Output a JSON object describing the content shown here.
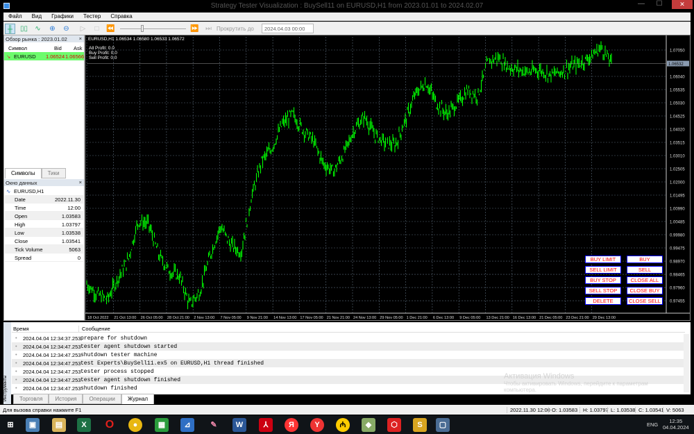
{
  "window": {
    "title": "Strategy Tester Visualization : BuySell11 on EURUSD,H1 from 2023.01.01 to 2024.02.07",
    "close": "✕",
    "minimize": "—",
    "maximize": "☐"
  },
  "menu": [
    "Файл",
    "Вид",
    "Графики",
    "Тестер",
    "Справка"
  ],
  "toolbar": {
    "scroll_to_label": "Прокрутить до",
    "scroll_to_date": "2024.04.03 00:00",
    "speed": 0.3
  },
  "market_watch": {
    "title": "Обзор рынка : 2023.01.02",
    "columns": [
      "Символ",
      "Bid",
      "Ask"
    ],
    "rows": [
      {
        "symbol": "EURUSD",
        "bid": "1.06524",
        "ask": "1.06566"
      }
    ],
    "tabs": [
      "Символы",
      "Тики"
    ]
  },
  "data_window": {
    "title": "Окно данных",
    "symbol": "EURUSD,H1",
    "rows": [
      {
        "k": "Date",
        "v": "2022.11.30"
      },
      {
        "k": "Time",
        "v": "12:00"
      },
      {
        "k": "Open",
        "v": "1.03583"
      },
      {
        "k": "High",
        "v": "1.03797"
      },
      {
        "k": "Low",
        "v": "1.03538"
      },
      {
        "k": "Close",
        "v": "1.03541"
      },
      {
        "k": "Tick Volume",
        "v": "5063"
      },
      {
        "k": "Spread",
        "v": "0"
      }
    ]
  },
  "chart": {
    "header": "EURUSD,H1  1.06534 1.06580 1.06533 1.06572",
    "info": [
      "All Profit: 0.0",
      "Buy Profit: 0.0",
      "Sell Profit: 0.0"
    ],
    "current_price": "1.06532",
    "buttons_left": [
      "BUY LIMIT",
      "SELL LIMIT",
      "BUY STOP",
      "SELL STOP",
      "DELETE"
    ],
    "buttons_right": [
      "BUY",
      "SELL",
      "CLOSE ALL",
      "CLOSE BUY",
      "CLOSE SELL"
    ],
    "colors": {
      "line": "#00ff00",
      "button_text": "#ff0000",
      "button_border": "#0000ff"
    }
  },
  "chart_data": {
    "type": "line",
    "title": "EURUSD,H1",
    "ylim": [
      0.96977,
      1.07555
    ],
    "y_ticks": [
      "1.07050",
      "1.06040",
      "1.05535",
      "1.05030",
      "1.04525",
      "1.04020",
      "1.03515",
      "1.03010",
      "1.02505",
      "1.02000",
      "1.01495",
      "1.00990",
      "1.00485",
      "0.99980",
      "0.99475",
      "0.98970",
      "0.98465",
      "0.97960",
      "0.97455"
    ],
    "x_ticks": [
      "18 Oct 2022",
      "21 Oct 13:00",
      "26 Oct 05:00",
      "28 Oct 21:00",
      "2 Nov 13:00",
      "7 Nov 05:00",
      "9 Nov 21:00",
      "14 Nov 13:00",
      "17 Nov 05:00",
      "21 Nov 21:00",
      "24 Nov 13:00",
      "29 Nov 05:00",
      "1 Dec 21:00",
      "6 Dec 13:00",
      "9 Dec 05:00",
      "13 Dec 21:00",
      "16 Dec 13:00",
      "21 Dec 05:00",
      "23 Dec 21:00",
      "29 Dec 13:00"
    ],
    "values": [
      0.981,
      0.977,
      0.975,
      0.983,
      0.99,
      1.005,
      1.004,
      0.992,
      0.986,
      0.984,
      0.973,
      0.978,
      0.992,
      1.003,
      0.996,
      0.993,
      1.014,
      1.028,
      1.033,
      1.042,
      1.046,
      1.04,
      1.036,
      1.027,
      1.024,
      1.031,
      1.04,
      1.045,
      1.038,
      1.035,
      1.034,
      1.044,
      1.054,
      1.058,
      1.05,
      1.046,
      1.05,
      1.055,
      1.053,
      1.066,
      1.0675,
      1.064,
      1.063,
      1.062,
      1.063,
      1.061,
      1.062,
      1.064,
      1.0655,
      1.068,
      1.0715,
      1.0655
    ]
  },
  "journal": {
    "columns": [
      "Время",
      "Сообщение"
    ],
    "rows": [
      {
        "t": "2024.04.04 12:34:37.253",
        "m": "prepare for shutdown"
      },
      {
        "t": "2024.04.04 12:34:47.253",
        "m": "tester agent shutdown started"
      },
      {
        "t": "2024.04.04 12:34:47.253",
        "m": "shutdown tester machine"
      },
      {
        "t": "2024.04.04 12:34:47.253",
        "m": "test Experts\\BuySell11.ex5 on EURUSD,H1 thread finished"
      },
      {
        "t": "2024.04.04 12:34:47.253",
        "m": "tester process stopped"
      },
      {
        "t": "2024.04.04 12:34:47.253",
        "m": "tester agent shutdown finished"
      },
      {
        "t": "2024.04.04 12:34:47.253",
        "m": "shutdown finished"
      }
    ],
    "tabs": [
      "Торговля",
      "История",
      "Операции",
      "Журнал"
    ],
    "side_label": "Инструменты"
  },
  "activation": {
    "title": "Активация Windows",
    "text": "Чтобы активировать Windows, перейдите к параметрам компьютера."
  },
  "status": {
    "help": "Для вызова справки нажмите F1",
    "datetime": "2022.11.30 12:00",
    "o": "O: 1.03583",
    "h": "H: 1.03797",
    "l": "L: 1.03538",
    "c": "C: 1.03541",
    "v": "V: 5063"
  },
  "taskbar": {
    "lang": "ENG",
    "time": "12:35",
    "date": "04.04.2024"
  }
}
